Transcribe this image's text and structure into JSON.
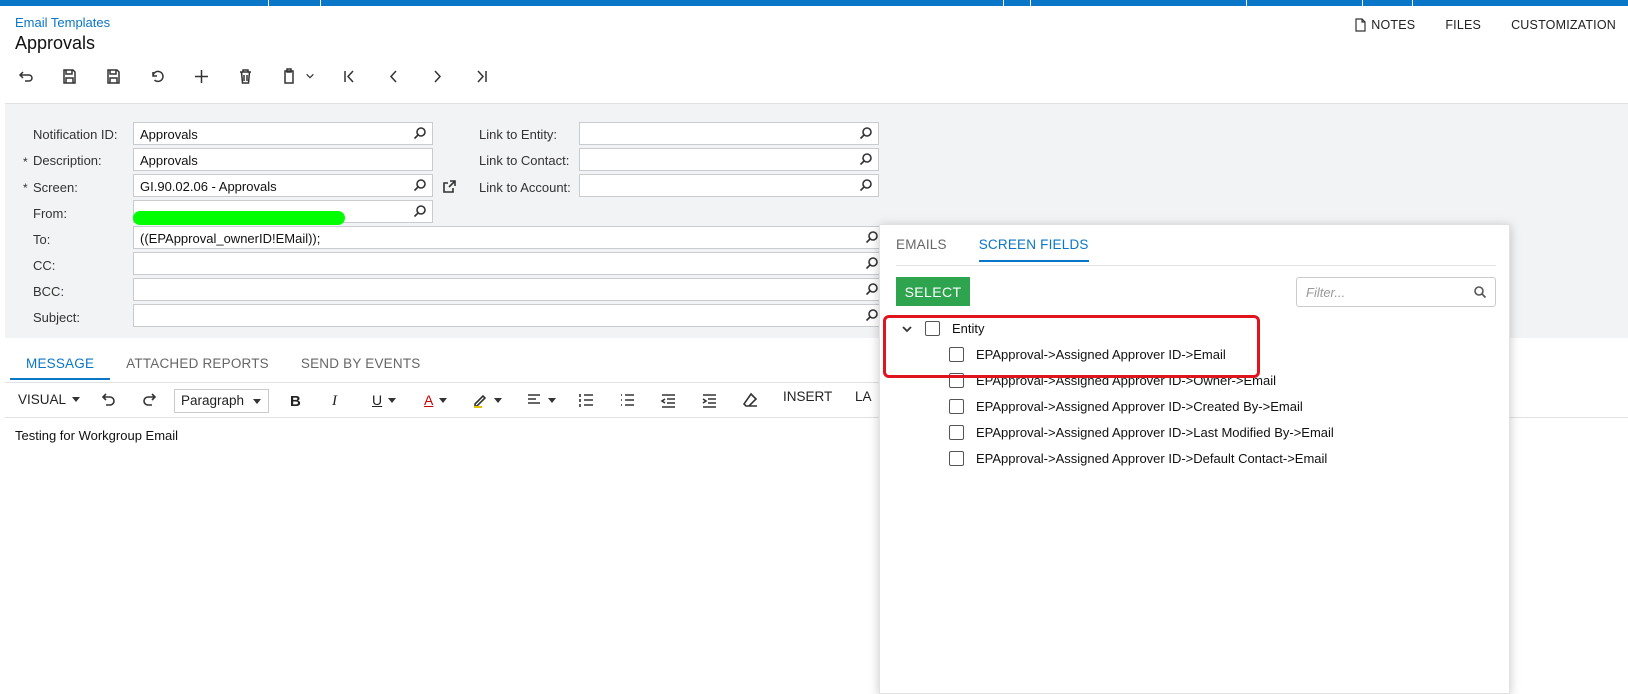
{
  "header": {
    "breadcrumb": "Email Templates",
    "title": "Approvals",
    "actions": [
      {
        "label": "NOTES",
        "icon": "note-icon"
      },
      {
        "label": "FILES"
      },
      {
        "label": "CUSTOMIZATION"
      }
    ]
  },
  "toolbar": {
    "icons": [
      "undo-back-icon",
      "save-close-icon",
      "save-icon",
      "cancel-icon",
      "add-icon",
      "delete-icon",
      "copy-paste-icon",
      "first-record-icon",
      "previous-record-icon",
      "next-record-icon",
      "last-record-icon"
    ]
  },
  "form": {
    "notification_id": {
      "label": "Notification ID:",
      "value": "Approvals"
    },
    "description": {
      "label": "Description:",
      "value": "Approvals",
      "required": "*"
    },
    "screen": {
      "label": "Screen:",
      "value": "GI.90.02.06 - Approvals",
      "required": "*"
    },
    "from": {
      "label": "From:",
      "value": ""
    },
    "to": {
      "label": "To:",
      "value": "((EPApproval_ownerID!EMail));"
    },
    "cc": {
      "label": "CC:",
      "value": ""
    },
    "bcc": {
      "label": "BCC:",
      "value": ""
    },
    "subject": {
      "label": "Subject:",
      "value": ""
    },
    "link_entity": {
      "label": "Link to Entity:",
      "value": ""
    },
    "link_contact": {
      "label": "Link to Contact:",
      "value": ""
    },
    "link_account": {
      "label": "Link to Account:",
      "value": ""
    }
  },
  "tabs": [
    "MESSAGE",
    "ATTACHED REPORTS",
    "SEND BY EVENTS"
  ],
  "editor": {
    "mode": "VISUAL",
    "paragraph": "Paragraph",
    "insert": "INSERT",
    "layout_partial": "LA",
    "content": "Testing for Workgroup Email"
  },
  "panel": {
    "tabs": [
      "EMAILS",
      "SCREEN FIELDS"
    ],
    "active_tab": "SCREEN FIELDS",
    "select_label": "SELECT",
    "filter_placeholder": "Filter...",
    "root": "Entity",
    "fields": [
      "EPApproval->Assigned Approver ID->Email",
      "EPApproval->Assigned Approver ID->Owner->Email",
      "EPApproval->Assigned Approver ID->Created By->Email",
      "EPApproval->Assigned Approver ID->Last Modified By->Email",
      "EPApproval->Assigned Approver ID->Default Contact->Email"
    ]
  },
  "colors": {
    "accent": "#0A76C8",
    "select_button": "#2ea44f",
    "highlight": "#e0141e"
  }
}
